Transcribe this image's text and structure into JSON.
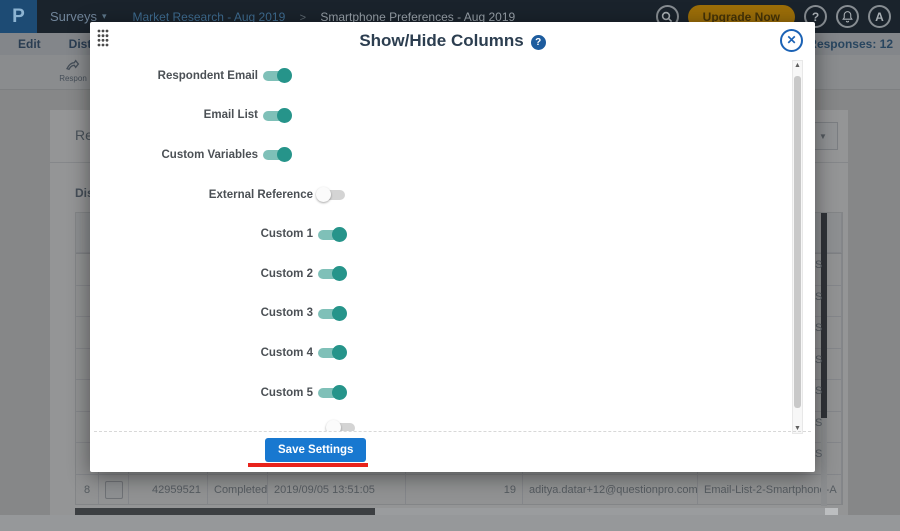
{
  "topbar": {
    "logo": "P",
    "product": "Surveys",
    "caret": "▾",
    "breadcrumb": {
      "parent": "Market Research - Aug 2019",
      "separator": ">",
      "current": "Smartphone Preferences - Aug 2019"
    },
    "upgrade": "Upgrade Now",
    "help": "?",
    "avatar": "A"
  },
  "nav": {
    "edit": "Edit",
    "distribute": "Distrib",
    "responses_count": "Responses: 12"
  },
  "toolbar": {
    "responses_tab": "Respon"
  },
  "card": {
    "title": "Re",
    "section": "Dis"
  },
  "modal": {
    "title": "Show/Hide Columns",
    "help": "?",
    "close": "✕",
    "toggles": [
      {
        "label": "Respondent Email",
        "on": true
      },
      {
        "label": "Email List",
        "on": true
      },
      {
        "label": "Custom Variables",
        "on": true
      },
      {
        "label": "External Reference",
        "on": false
      },
      {
        "label": "Custom 1",
        "on": true
      },
      {
        "label": "Custom 2",
        "on": true
      },
      {
        "label": "Custom 3",
        "on": true
      },
      {
        "label": "Custom 4",
        "on": true
      },
      {
        "label": "Custom 5",
        "on": true
      }
    ],
    "save": "Save Settings",
    "scrollbar_up": "▲",
    "scrollbar_down": "▼",
    "colors": {
      "accent_blue": "#1878d0",
      "toggle_on": "#26948a",
      "annotation_red": "#e8231c",
      "help_blue": "#1d5c9e"
    }
  },
  "table": {
    "row8": {
      "num": "8",
      "response_id": "42959521",
      "status": "Completed",
      "timestamp": "2019/09/05 13:51:05",
      "time_taken": "19",
      "email": "aditya.datar+12@questionpro.com",
      "email_list": "Email-List-2-Smartphone-A"
    },
    "edge_texts": [
      "S",
      "S",
      "S",
      "S",
      "S",
      "S",
      "S"
    ]
  }
}
